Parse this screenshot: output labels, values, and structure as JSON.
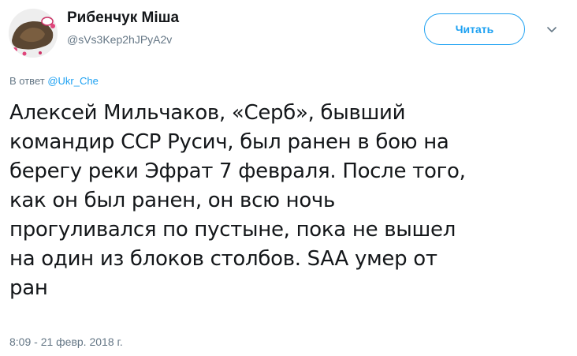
{
  "user": {
    "name": "Рибенчук Міша",
    "handle": "@sVs3Kep2hJPyA2v"
  },
  "follow_button": {
    "label": "Читать"
  },
  "reply": {
    "prefix": "В ответ",
    "mention": "@Ukr_Che"
  },
  "tweet": {
    "lines": [
      "Алексей Мильчаков, «Серб», бывший",
      "командир ССР Русич, был ранен в бою на",
      "берегу реки Эфрат 7 февраля. После того,",
      "как он был ранен, он всю ночь",
      "прогуливался по пустыне, пока не вышел",
      "на один из блоков столбов. SAA умер от",
      "ран"
    ]
  },
  "timestamp": "8:09 - 21 февр. 2018 г.",
  "colors": {
    "accent": "#1da1f2",
    "secondary_text": "#657786",
    "primary_text": "#14171a"
  },
  "icons": {
    "more": "chevron-down-icon"
  }
}
